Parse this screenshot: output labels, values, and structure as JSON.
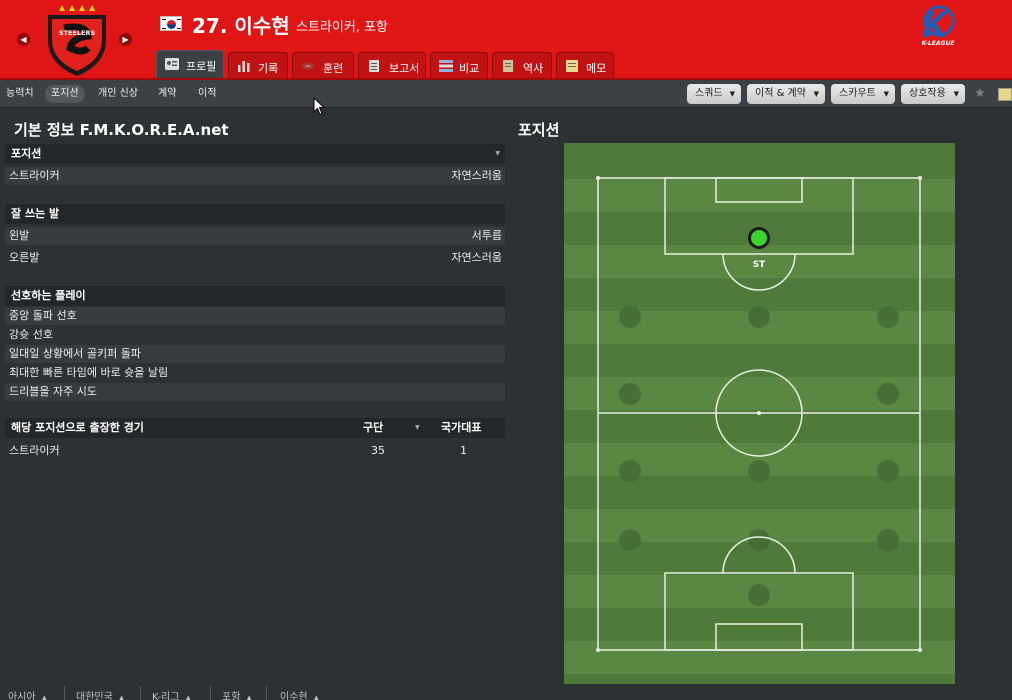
{
  "header": {
    "title": "27. 이수현",
    "subtitle": "스트라이커, 포항",
    "club_crest_text": "STEELERS",
    "league_logo_text": "K-LEAGUE",
    "colors": {
      "bar": "#e01616",
      "tab": "#c11313",
      "active_tab": "#3a4044"
    },
    "tabs": [
      {
        "label": "프로필",
        "icon": "profile-card-icon"
      },
      {
        "label": "기록",
        "icon": "bar-stats-icon"
      },
      {
        "label": "훈련",
        "icon": "training-icon"
      },
      {
        "label": "보고서",
        "icon": "report-icon"
      },
      {
        "label": "비교",
        "icon": "compare-icon"
      },
      {
        "label": "역사",
        "icon": "history-icon"
      },
      {
        "label": "메모",
        "icon": "memo-icon"
      }
    ]
  },
  "subnav": {
    "items": [
      "능력치",
      "포지션",
      "개인 신상",
      "계약",
      "이적"
    ],
    "active": "포지션",
    "menus": [
      "스쿼드",
      "이적 & 계약",
      "스카우트",
      "상호작용"
    ]
  },
  "left": {
    "heading": "기본 정보 F.M.K.O.R.E.A.net",
    "positions": {
      "header": "포지션",
      "rows": [
        {
          "name": "스트라이커",
          "rating": "자연스러움"
        }
      ]
    },
    "foot": {
      "header": "잘 쓰는 발",
      "rows": [
        {
          "name": "왼발",
          "rating": "서투름"
        },
        {
          "name": "오른발",
          "rating": "자연스러움"
        }
      ]
    },
    "play": {
      "header": "선호하는 플레이",
      "rows": [
        "중앙 돌파 선호",
        "강슛 선호",
        "일대일 상황에서 골키퍼 돌파",
        "최대한 빠른 타임에 바로 슛을 날림",
        "드리블을 자주 시도"
      ]
    },
    "apps": {
      "header": "해당 포지션으로 출장한 경기",
      "col_club": "구단",
      "col_nat": "국가대표",
      "rows": [
        {
          "name": "스트라이커",
          "club": "35",
          "nat": "1"
        }
      ]
    }
  },
  "right": {
    "heading": "포지션",
    "position_label": "ST",
    "marker_color": "#3ad62e"
  },
  "breadcrumbs": [
    "아시아",
    "대한민국",
    "K-리그",
    "포항",
    "이수현"
  ]
}
